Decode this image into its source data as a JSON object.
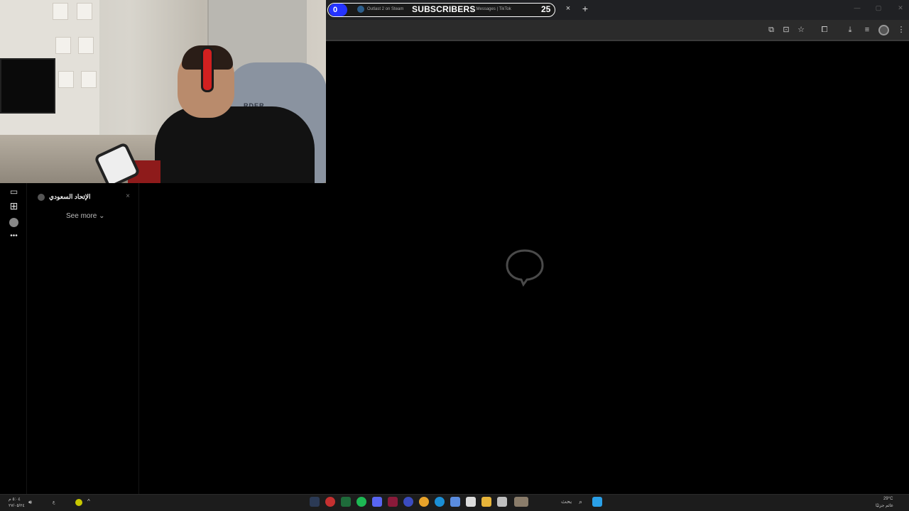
{
  "browser": {
    "sub_counter_value": "0",
    "subscribers_label": "SUBSCRIBERS",
    "subscribers_count": "25",
    "tab_steam_title": "Outlast 2 on Steam",
    "tab_tiktok_title": "Messages | TikTok",
    "tab_close_glyph": "×",
    "new_tab_glyph": "+"
  },
  "webcam": {
    "chair_text": "RDER"
  },
  "sidebar": {
    "title": "الإتحاد السعودي",
    "close_glyph": "×",
    "see_more": "See more ⌄",
    "more_glyph": "•••"
  },
  "taskbar": {
    "search_text": "بحث",
    "clock_time": "٥:٠٤ م",
    "clock_date": "٢٧/٠٥/٢٤",
    "weather_temp": "29°C",
    "weather_desc": "غائم جزئيًا",
    "lang": "ع"
  },
  "colors": {
    "accent_blue": "#2533ff",
    "background": "#000000",
    "taskbar": "#1c1c1c"
  },
  "icons": [
    "comment-icon",
    "add-square-icon",
    "more-icon",
    "refresh-icon",
    "translate-icon",
    "star-icon",
    "extensions-icon",
    "download-icon",
    "media-icon",
    "kebab-icon",
    "chat-bubble-icon"
  ]
}
